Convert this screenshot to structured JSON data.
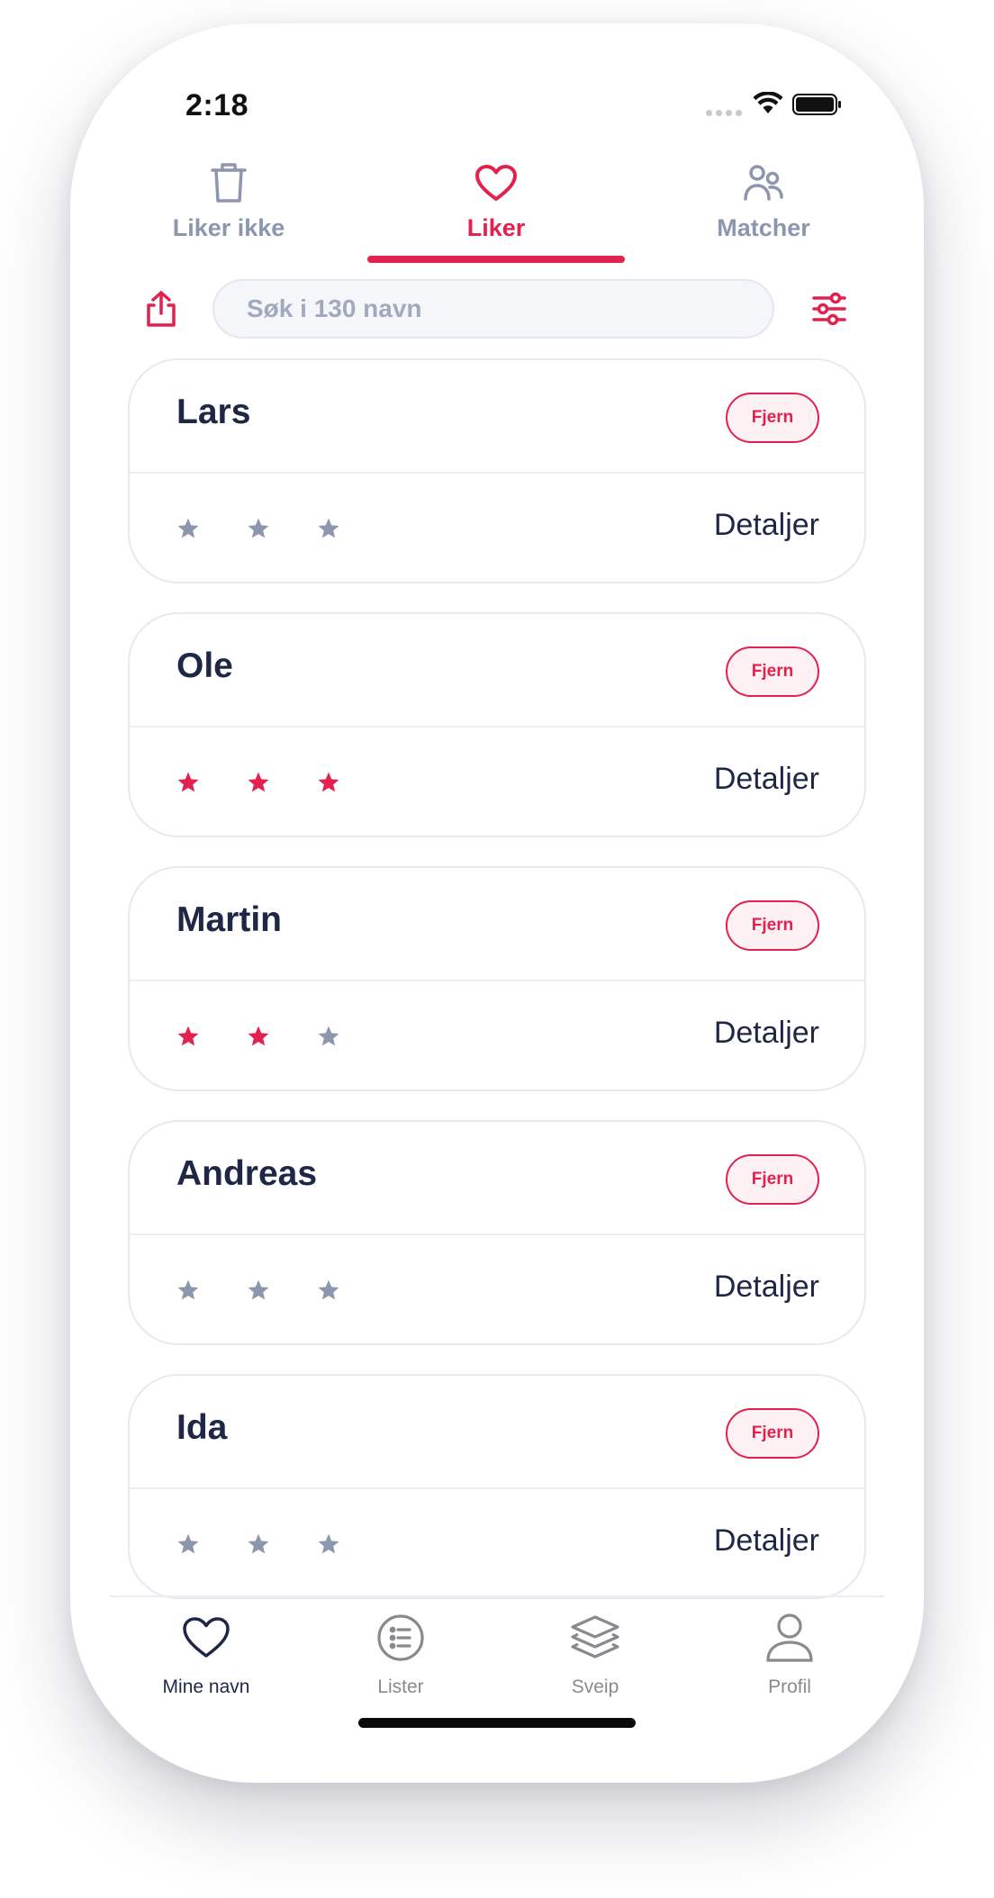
{
  "status_bar": {
    "time": "2:18"
  },
  "top_tabs": [
    {
      "label": "Liker ikke",
      "icon": "trash-icon",
      "active": false
    },
    {
      "label": "Liker",
      "icon": "heart-icon",
      "active": true
    },
    {
      "label": "Matcher",
      "icon": "people-icon",
      "active": false
    }
  ],
  "search": {
    "placeholder": "Søk i 130 navn",
    "value": ""
  },
  "names": [
    {
      "name": "Lars",
      "remove_label": "Fjern",
      "details_label": "Detaljer",
      "rating": 0,
      "max_rating": 3
    },
    {
      "name": "Ole",
      "remove_label": "Fjern",
      "details_label": "Detaljer",
      "rating": 3,
      "max_rating": 3
    },
    {
      "name": "Martin",
      "remove_label": "Fjern",
      "details_label": "Detaljer",
      "rating": 2,
      "max_rating": 3
    },
    {
      "name": "Andreas",
      "remove_label": "Fjern",
      "details_label": "Detaljer",
      "rating": 0,
      "max_rating": 3
    },
    {
      "name": "Ida",
      "remove_label": "Fjern",
      "details_label": "Detaljer",
      "rating": 0,
      "max_rating": 3
    }
  ],
  "bottom_nav": [
    {
      "label": "Mine navn",
      "icon": "heart-icon",
      "active": true
    },
    {
      "label": "Lister",
      "icon": "list-icon",
      "active": false
    },
    {
      "label": "Sveip",
      "icon": "layers-icon",
      "active": false
    },
    {
      "label": "Profil",
      "icon": "person-icon",
      "active": false
    }
  ],
  "colors": {
    "accent": "#e3214e",
    "inactive_star": "#8c96ad",
    "text_dark": "#1f2746",
    "muted": "#8c96ad"
  }
}
